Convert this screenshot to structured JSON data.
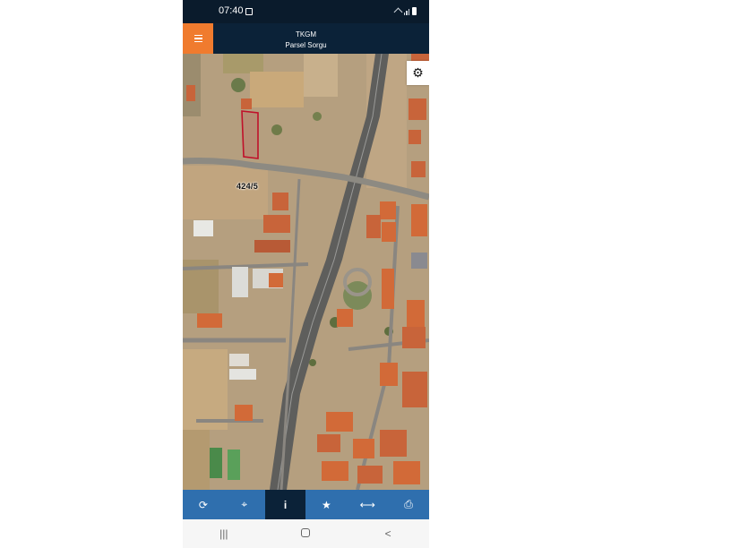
{
  "status_bar": {
    "time": "07:40"
  },
  "header": {
    "title": "TKGM",
    "subtitle": "Parsel Sorgu"
  },
  "map": {
    "parcel_label": "424/5",
    "parcel_outline_color": "#c0102a"
  },
  "colors": {
    "header_bg": "#0b2238",
    "menu_accent": "#f07b2e",
    "toolbar_bg": "#2f6fae",
    "toolbar_active": "#0b2238"
  },
  "icons": {
    "menu": "hamburger-icon",
    "settings": "gear-icon",
    "toolbar": [
      "refresh-icon",
      "locate-icon",
      "info-icon",
      "star-icon",
      "measure-icon",
      "print-icon"
    ],
    "nav": [
      "recent-apps-icon",
      "home-icon",
      "back-icon"
    ]
  },
  "toolbar": {
    "active_index": 2
  }
}
